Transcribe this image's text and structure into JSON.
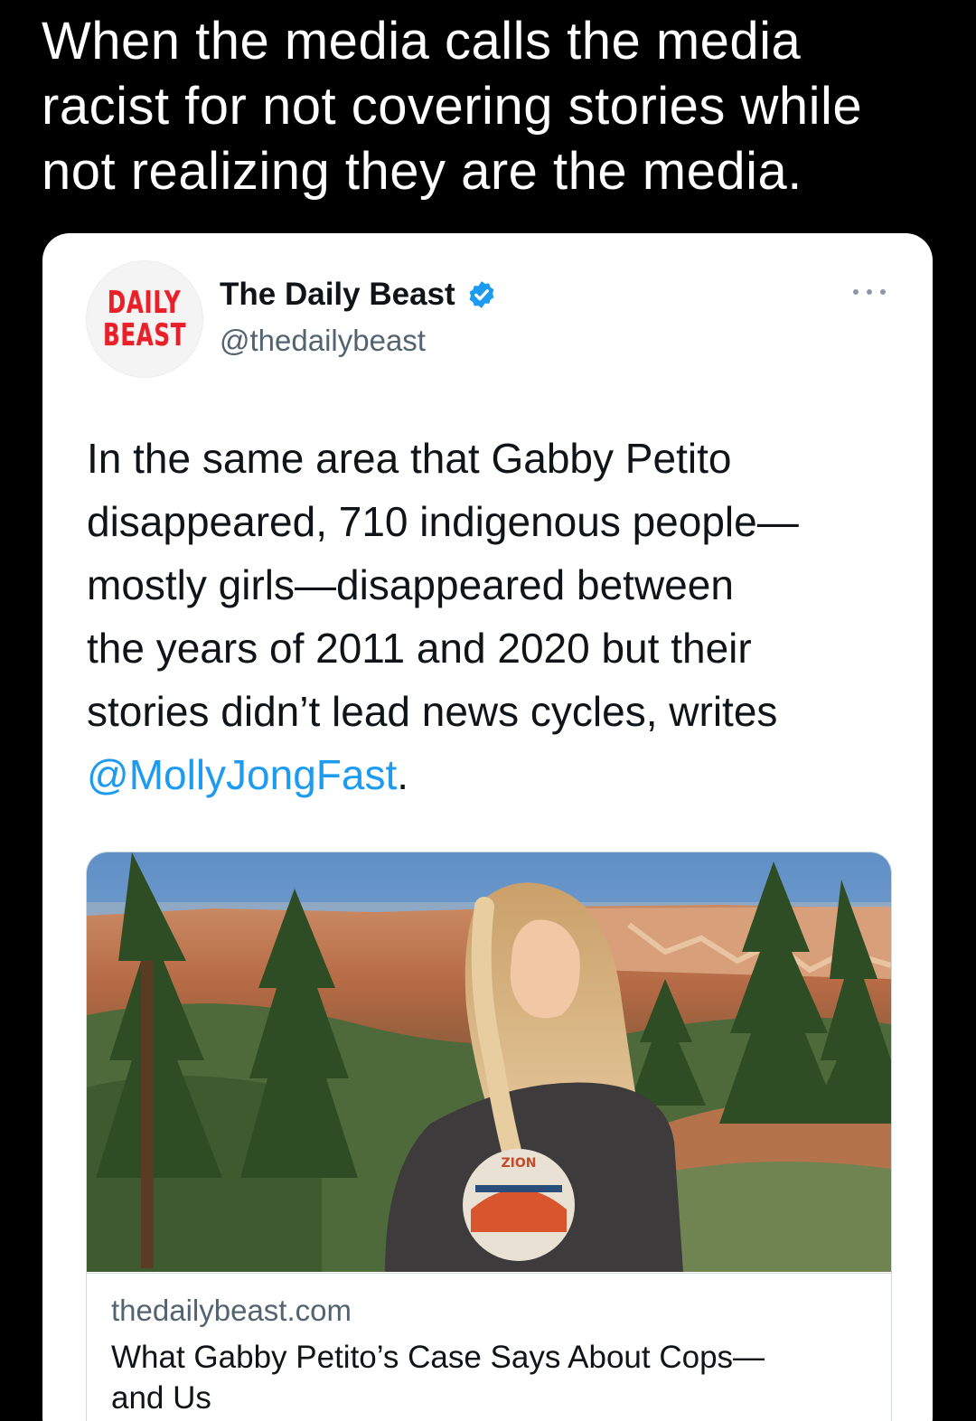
{
  "caption": {
    "lines": [
      "When the media calls the media",
      "racist for not covering stories while",
      "not realizing they are the media."
    ]
  },
  "tweet": {
    "avatar": {
      "logo_line1": "DAILY",
      "logo_line2": "BEAST"
    },
    "account_name": "The Daily Beast",
    "handle": "@thedailybeast",
    "verified": true,
    "text_lines": [
      "In the same area that Gabby Petito",
      "disappeared, 710 indigenous people—",
      "mostly girls—disappeared between",
      "the years of 2011 and 2020 but their",
      "stories didn’t lead news cycles, writes"
    ],
    "mention": "@MollyJongFast",
    "mention_suffix": ".",
    "link_card": {
      "image_icon": "photo-woman-in-forest-canyon",
      "shirt_text": "ZION",
      "domain": "thedailybeast.com",
      "title_lines": [
        "What Gabby Petito’s Case Says About Cops—",
        "and Us"
      ]
    }
  },
  "colors": {
    "background": "#000000",
    "card": "#ffffff",
    "text_primary": "#0f1419",
    "text_secondary": "#536471",
    "link_blue": "#1d9bf0",
    "verified_blue": "#1d9bf0",
    "logo_red": "#e8202a"
  }
}
